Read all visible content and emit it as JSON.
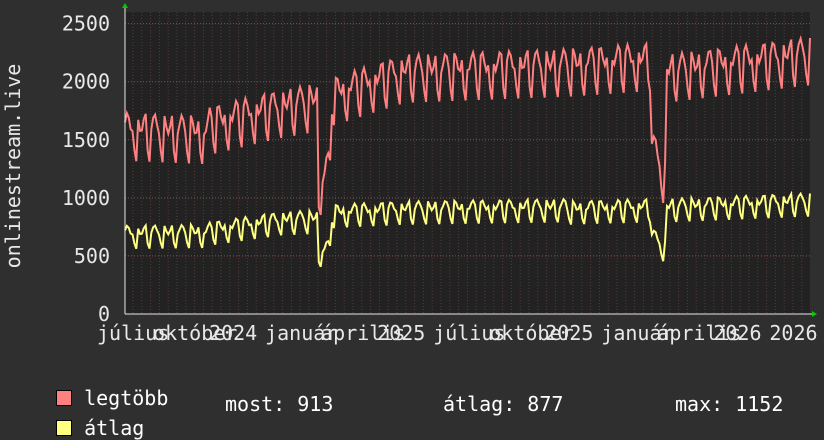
{
  "colors": {
    "background": "#2f2f2f",
    "plot_background": "#222222",
    "grid": "#5a3a3a",
    "max_series": "#ff8080",
    "avg_series": "#ffff80",
    "axis": "#e8e8e8",
    "arrow": "#00cc00"
  },
  "chart_data": {
    "type": "line",
    "ylabel": "onlinestream.live",
    "ylim": [
      0,
      2600
    ],
    "yticks": [
      0,
      500,
      1000,
      1500,
      2000,
      2500
    ],
    "xticks": [
      "július",
      "október",
      "2024",
      "január",
      "április",
      "2025",
      "július",
      "október",
      "2025",
      "január",
      "április",
      "2026",
      "2026"
    ],
    "n_points": 365,
    "series": [
      {
        "name": "legtöbb",
        "color": "#ff8080",
        "segments": [
          {
            "from": 0,
            "to": 45,
            "start": 1650,
            "end": 1620
          },
          {
            "from": 45,
            "to": 85,
            "start": 1700,
            "end": 1850
          },
          {
            "from": 85,
            "to": 103,
            "start": 1850,
            "end": 1900
          },
          {
            "from": 103,
            "to": 110,
            "start": 1150,
            "end": 1350
          },
          {
            "from": 110,
            "to": 150,
            "start": 1950,
            "end": 2150
          },
          {
            "from": 150,
            "to": 235,
            "start": 2150,
            "end": 2200
          },
          {
            "from": 235,
            "to": 280,
            "start": 2200,
            "end": 2250
          },
          {
            "from": 280,
            "to": 288,
            "start": 1500,
            "end": 1250
          },
          {
            "from": 288,
            "to": 365,
            "start": 2150,
            "end": 2300
          }
        ]
      },
      {
        "name": "átlag",
        "color": "#ffff80",
        "segments": [
          {
            "from": 0,
            "to": 45,
            "start": 720,
            "end": 730
          },
          {
            "from": 45,
            "to": 85,
            "start": 750,
            "end": 840
          },
          {
            "from": 85,
            "to": 103,
            "start": 840,
            "end": 850
          },
          {
            "from": 103,
            "to": 110,
            "start": 560,
            "end": 600
          },
          {
            "from": 110,
            "to": 150,
            "start": 900,
            "end": 930
          },
          {
            "from": 150,
            "to": 235,
            "start": 930,
            "end": 950
          },
          {
            "from": 235,
            "to": 280,
            "start": 930,
            "end": 950
          },
          {
            "from": 280,
            "to": 288,
            "start": 700,
            "end": 600
          },
          {
            "from": 288,
            "to": 365,
            "start": 950,
            "end": 1000
          }
        ]
      }
    ],
    "stats": {
      "most_label": "most:",
      "most_value": "913",
      "avg_label": "átlag:",
      "avg_value": "877",
      "max_label": "max:",
      "max_value": "1152"
    }
  },
  "legend": {
    "max_label": "legtöbb",
    "avg_label": "átlag"
  }
}
